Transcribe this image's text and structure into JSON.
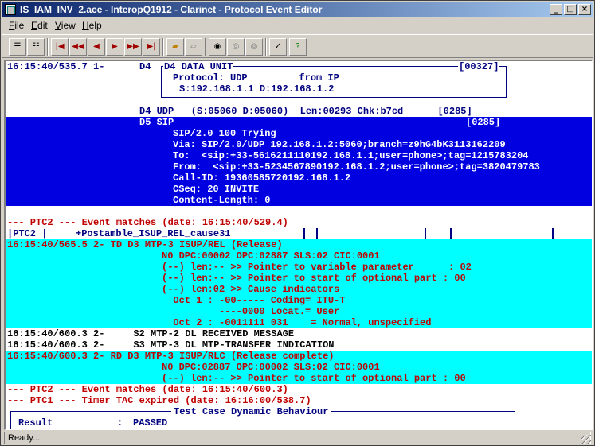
{
  "window": {
    "title": "IS_IAM_INV_2.ace - InteropQ1912 - Clarinet - Protocol Event Editor",
    "controls": [
      "_",
      "□",
      "×"
    ]
  },
  "menu": {
    "file": "File",
    "file_key": "F",
    "file_rest": "ile",
    "edit": "Edit",
    "edit_key": "E",
    "edit_rest": "dit",
    "view": "View",
    "view_key": "V",
    "view_rest": "iew",
    "help": "Help",
    "help_key": "H",
    "help_rest": "elp"
  },
  "toolbar": {
    "icons": [
      "list-collapse-icon",
      "list-expand-icon",
      "first-icon",
      "fast-back-icon",
      "back-icon",
      "forward-icon",
      "fast-forward-icon",
      "last-icon",
      "open-folder-icon",
      "open-file-icon",
      "find-icon",
      "find-prev-icon",
      "find-next-icon",
      "check-icon",
      "help-icon"
    ]
  },
  "log": {
    "l1_ts": "16:15:40/535.7 1-",
    "l1_d4": "D4",
    "du_title": "D4 DATA UNIT",
    "du_ref": "[00327]",
    "du_proto": "Protocol: UDP         from IP",
    "du_addr": "S:192.168.1.1 D:192.168.1.2",
    "udp": "D4 UDP   (S:05060 D:05060)  Len:00293 Chk:b7cd      [0285]",
    "sip_head": "D5 SIP",
    "sip_ref": "[0285]",
    "sip_lines": [
      "SIP/2.0 100 Trying",
      "Via: SIP/2.0/UDP 192.168.1.2:5060;branch=z9hG4bK3113162209",
      "To:  <sip:+33-5616211110192.168.1.1;user=phone>;tag=1215783204",
      "From:  <sip:+33-5234567890192.168.1.2;user=phone>;tag=3820479783",
      "Call-ID: 19360585720192.168.1.2",
      "CSeq: 20 INVITE",
      "Content-Length: 0"
    ],
    "ptc2_match1": "--- PTC2 --- Event matches (date: 16:15:40/529.4)",
    "ptc2_label": "|PTC2 |",
    "postamble": "+Postamble_ISUP_REL_cause31",
    "rel_head": "16:15:40/565.5 2- TD D3 MTP-3 ISUP/REL (Release)",
    "rel_lines": [
      "N0 DPC:00002 OPC:02887 SLS:02 CIC:0001",
      "(--) len:-- >> Pointer to variable parameter      : 02",
      "(--) len:-- >> Pointer to start of optional part : 00",
      "(--) len:02 >> Cause indicators",
      "  Oct 1 : -00----- Coding= ITU-T",
      "          ----0000 Locat.= User",
      "  Oct 2 : -0011111 031    = Normal, unspecified"
    ],
    "s2_line": "16:15:40/600.3 2-     S2 MTP-2 DL RECEIVED MESSAGE",
    "s3_line": "16:15:40/600.3 2-     S3 MTP-3 DL MTP-TRANSFER INDICATION",
    "rlc_head": "16:15:40/600.3 2- RD D3 MTP-3 ISUP/RLC (Release complete)",
    "rlc_lines": [
      "N0 DPC:02887 OPC:00002 SLS:02 CIC:0001",
      "(--) len:-- >> Pointer to start of optional part : 00"
    ],
    "ptc2_match2": "--- PTC2 --- Event matches (date: 16:15:40/600.3)",
    "ptc1_timer": "--- PTC1 --- Timer TAC expired (date: 16:16:00/538.7)",
    "tc_title": "Test Case Dynamic Behaviour",
    "result_label": "Result",
    "result_sep": ":",
    "result_value": "PASSED"
  },
  "status": {
    "text": "Ready..."
  }
}
